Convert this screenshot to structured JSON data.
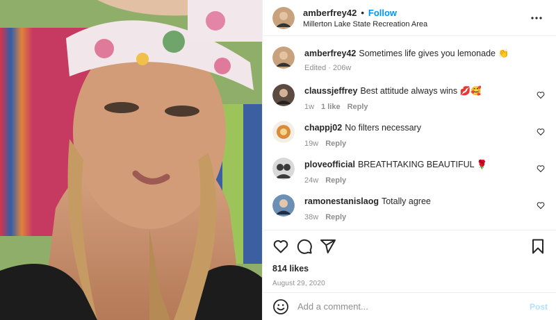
{
  "post": {
    "username": "amberfrey42",
    "separator": "•",
    "follow_label": "Follow",
    "location": "Millerton Lake State Recreation Area"
  },
  "caption": {
    "username": "amberfrey42",
    "text": "Sometimes life gives you lemonade 👏",
    "meta": "Edited · 206w"
  },
  "comments": [
    {
      "username": "claussjeffrey",
      "text": "Best attitude always wins 💋🥰",
      "age": "1w",
      "likes": "1 like",
      "reply": "Reply",
      "avatar_color": "#5a4a3f"
    },
    {
      "username": "chappj02",
      "text": "No filters necessary",
      "age": "19w",
      "reply": "Reply",
      "avatar_color": "#d98c3a"
    },
    {
      "username": "plovеofficial",
      "text": "BREATHTAKING BEAUTIFUL 🌹",
      "age": "24w",
      "reply": "Reply",
      "avatar_color": "#3b3b3b"
    },
    {
      "username": "ramonestanislaog",
      "text": "Totally agree",
      "age": "38w",
      "reply": "Reply",
      "avatar_color": "#6c8fb5"
    }
  ],
  "engagement": {
    "likes": "814 likes",
    "date": "August 29, 2020"
  },
  "composer": {
    "placeholder": "Add a comment...",
    "post_label": "Post"
  },
  "colors": {
    "accent": "#0095f6",
    "muted": "#8e8e8e",
    "post_disabled": "#b2dffc"
  }
}
